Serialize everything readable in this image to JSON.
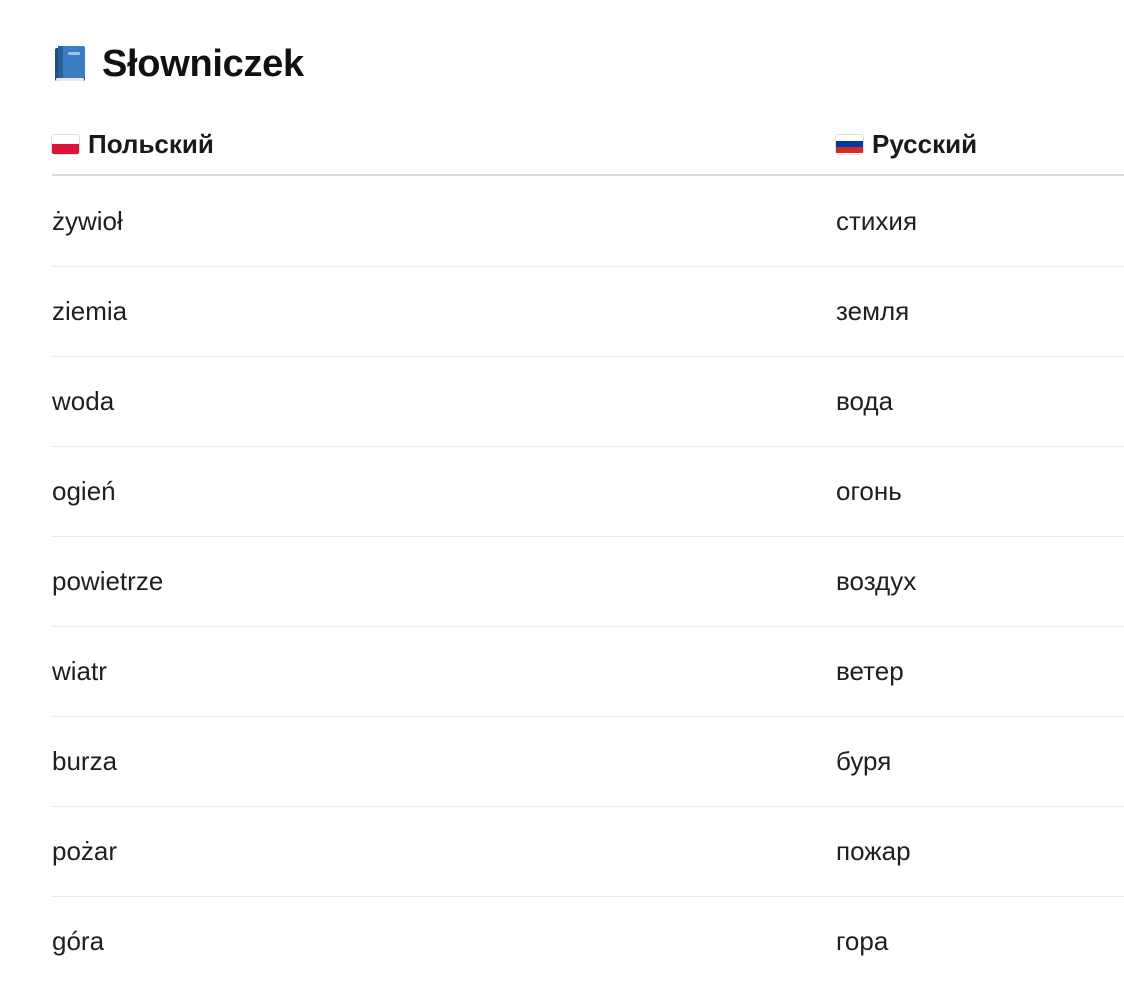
{
  "title": "Słowniczek",
  "title_icon": "blue-book-icon",
  "columns": {
    "polish": {
      "label": "Польский",
      "flag_icon": "poland-flag-icon",
      "flag_colors": [
        "#ffffff",
        "#dc143c"
      ]
    },
    "russian": {
      "label": "Русский",
      "flag_icon": "russia-flag-icon",
      "flag_colors": [
        "#ffffff",
        "#0039a6",
        "#d52b1e"
      ]
    }
  },
  "rows": [
    {
      "pl": "żywioł",
      "ru": "стихия"
    },
    {
      "pl": "ziemia",
      "ru": "земля"
    },
    {
      "pl": "woda",
      "ru": "вода"
    },
    {
      "pl": "ogień",
      "ru": "огонь"
    },
    {
      "pl": "powietrze",
      "ru": "воздух"
    },
    {
      "pl": "wiatr",
      "ru": "ветер"
    },
    {
      "pl": "burza",
      "ru": "буря"
    },
    {
      "pl": "pożar",
      "ru": "пожар"
    },
    {
      "pl": "góra",
      "ru": "гора"
    }
  ]
}
